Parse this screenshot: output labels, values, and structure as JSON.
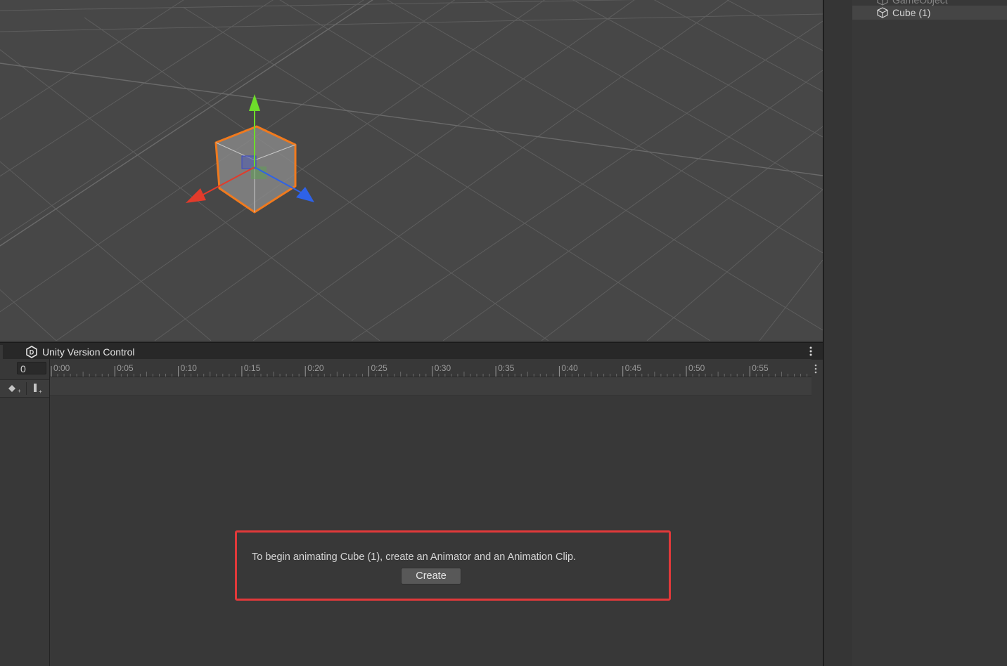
{
  "hierarchy": {
    "rows": [
      {
        "label": "GameObject",
        "selected": false
      },
      {
        "label": "Cube (1)",
        "selected": true
      }
    ]
  },
  "animation_window": {
    "tab_label": "Unity Version Control",
    "frame_value": "0",
    "ruler_labels": [
      "0:00",
      "0:05",
      "0:10",
      "0:15",
      "0:20",
      "0:25",
      "0:30",
      "0:35",
      "0:40",
      "0:45",
      "0:50",
      "0:55"
    ],
    "tools": [
      {
        "icon": "add-keyframe-icon"
      },
      {
        "icon": "add-event-icon"
      }
    ]
  },
  "prompt": {
    "message": "To begin animating Cube (1), create an Animator and an Animation Clip.",
    "create_label": "Create"
  },
  "colors": {
    "highlight_border": "#e2393a",
    "axis_x": "#e23b2b",
    "axis_y": "#6ddc2a",
    "axis_z": "#2e62e8",
    "selection_outline": "#f07a1e"
  }
}
